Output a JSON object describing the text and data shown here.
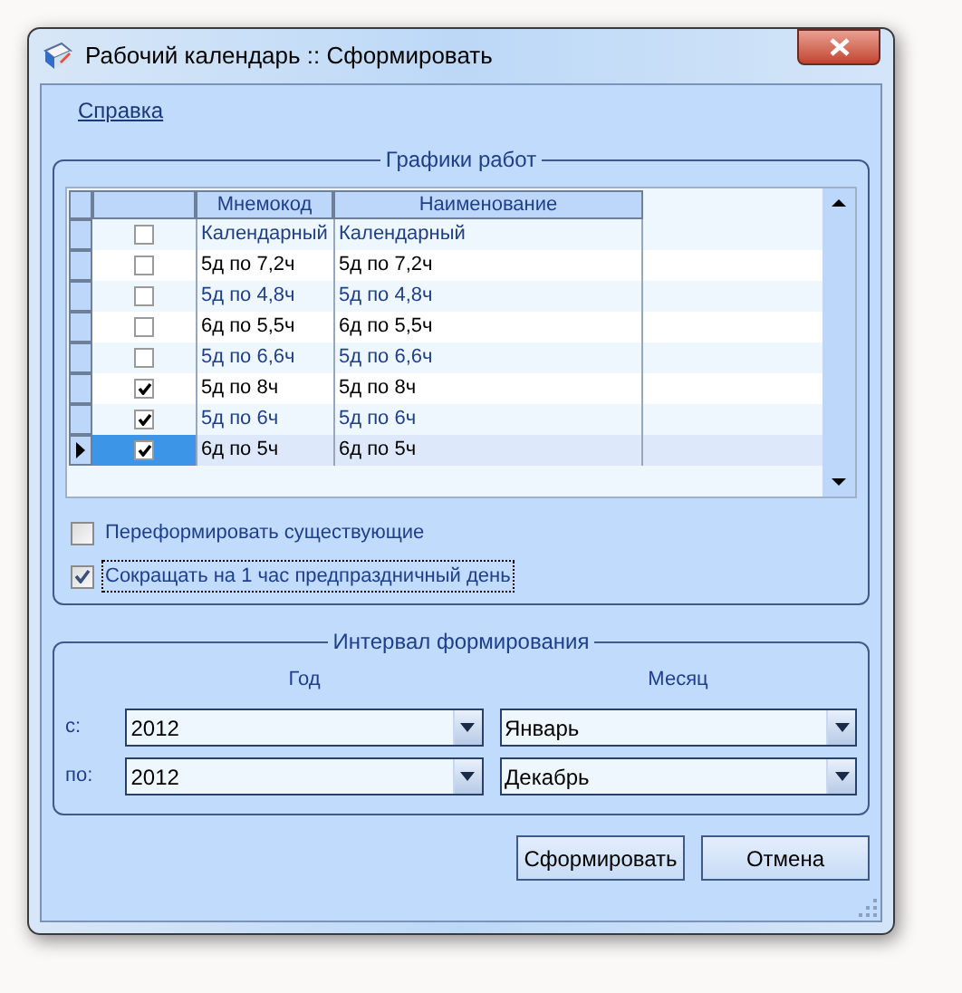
{
  "window": {
    "title": "Рабочий календарь :: Сформировать"
  },
  "menu": [
    "Справка"
  ],
  "schedules": {
    "title": "Графики работ",
    "columns": [
      "Мнемокод",
      "Наименование"
    ],
    "rows": [
      {
        "checked": false,
        "selected": false,
        "code": "Календарный",
        "name": "Календарный"
      },
      {
        "checked": false,
        "selected": false,
        "code": "5д по 7,2ч",
        "name": "5д по 7,2ч"
      },
      {
        "checked": false,
        "selected": false,
        "code": "5д по 4,8ч",
        "name": "5д по 4,8ч"
      },
      {
        "checked": false,
        "selected": false,
        "code": "6д по 5,5ч",
        "name": "6д по 5,5ч"
      },
      {
        "checked": false,
        "selected": false,
        "code": "5д по 6,6ч",
        "name": "5д по 6,6ч"
      },
      {
        "checked": true,
        "selected": false,
        "code": "5д по 8ч",
        "name": "5д по 8ч"
      },
      {
        "checked": true,
        "selected": false,
        "code": "5д по 6ч",
        "name": "5д по 6ч"
      },
      {
        "checked": true,
        "selected": true,
        "code": "6д по 5ч",
        "name": "6д по 5ч"
      }
    ],
    "options": [
      {
        "label": "Переформировать существующие",
        "checked": false,
        "focused": false
      },
      {
        "label": "Сокращать на 1 час предпраздничный день",
        "checked": true,
        "focused": true
      }
    ]
  },
  "interval": {
    "title": "Интервал формирования",
    "year_header": "Год",
    "month_header": "Месяц",
    "rows": [
      {
        "label": "с:",
        "year": "2012",
        "month": "Январь"
      },
      {
        "label": "по:",
        "year": "2012",
        "month": "Декабрь"
      }
    ]
  },
  "buttons": [
    "Сформировать",
    "Отмена"
  ]
}
